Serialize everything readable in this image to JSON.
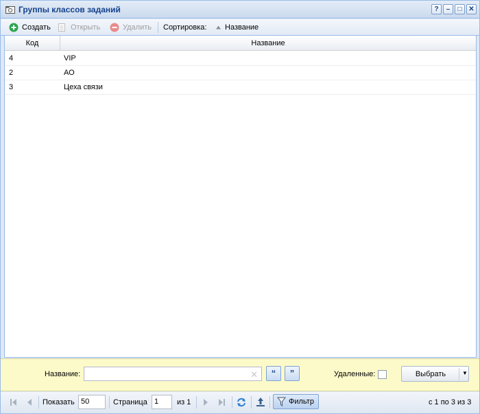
{
  "window": {
    "title": "Группы классов заданий",
    "buttons": {
      "help": "?",
      "minimize": "–",
      "maximize": "□",
      "close": "✕"
    }
  },
  "toolbar": {
    "create_label": "Создать",
    "open_label": "Открыть",
    "delete_label": "Удалить",
    "sort_label": "Сортировка:",
    "sort_field": "Название"
  },
  "grid": {
    "columns": [
      "Код",
      "Название"
    ],
    "rows": [
      {
        "code": "4",
        "name": "VIP"
      },
      {
        "code": "2",
        "name": "АО"
      },
      {
        "code": "3",
        "name": "Цеха связи"
      }
    ]
  },
  "filter": {
    "name_label": "Название:",
    "name_value": "",
    "clear_glyph": "✕",
    "quote_open": "“",
    "quote_close": "”",
    "deleted_label": "Удаленные:",
    "select_label": "Выбрать"
  },
  "pager": {
    "show_label": "Показать",
    "page_size": "50",
    "page_label": "Страница",
    "page_value": "1",
    "of_label": "из 1",
    "filter_label": "Фильтр",
    "range_text": "с 1 по 3 из 3"
  },
  "colors": {
    "title_text": "#15428b",
    "border": "#99bbe8",
    "filter_bg": "#fcfac9",
    "create_icon": "#2ea44f",
    "delete_icon": "#e88c8c"
  },
  "icons": [
    "window-icon",
    "add-icon",
    "open-icon",
    "delete-icon",
    "sort-asc-icon",
    "first-page-icon",
    "prev-page-icon",
    "next-page-icon",
    "last-page-icon",
    "refresh-icon",
    "export-icon",
    "filter-icon"
  ]
}
